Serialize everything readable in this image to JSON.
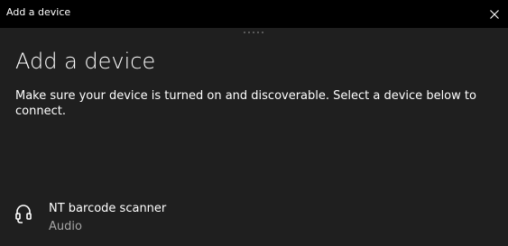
{
  "window": {
    "title": "Add a device",
    "close_icon": "close-icon"
  },
  "main": {
    "heading": "Add a device",
    "description": "Make sure your device is turned on and discoverable. Select a device below to connect."
  },
  "devices": [
    {
      "name": "NT barcode scanner",
      "type": "Audio",
      "icon": "headset-icon"
    }
  ],
  "colors": {
    "titlebar": "#000000",
    "background": "#1f1f1f",
    "text": "#ffffff",
    "secondary_text": "#a6a6a6"
  }
}
